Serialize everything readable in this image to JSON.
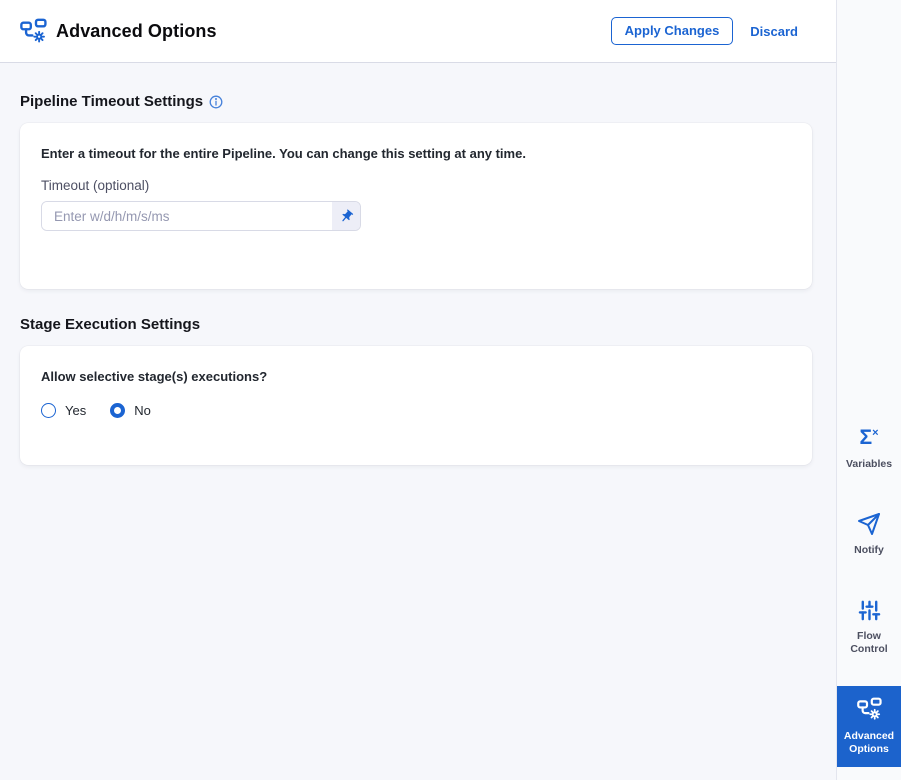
{
  "header": {
    "title": "Advanced Options",
    "apply_label": "Apply Changes",
    "discard_label": "Discard",
    "icon": "pipeline-gear-icon"
  },
  "pipeline_timeout": {
    "section_title": "Pipeline Timeout Settings",
    "info_icon": "info-icon",
    "description": "Enter a timeout for the entire Pipeline. You can change this setting at any time.",
    "timeout_label": "Timeout (optional)",
    "timeout_value": "",
    "timeout_placeholder": "Enter w/d/h/m/s/ms",
    "pin_icon": "pin-icon"
  },
  "stage_execution": {
    "section_title": "Stage Execution Settings",
    "question": "Allow selective stage(s) executions?",
    "options": [
      {
        "label": "Yes",
        "selected": false
      },
      {
        "label": "No",
        "selected": true
      }
    ]
  },
  "sidebar": {
    "items": [
      {
        "label": "Variables",
        "icon": "sigma-x-icon",
        "selected": false
      },
      {
        "label": "Notify",
        "icon": "paper-plane-icon",
        "selected": false
      },
      {
        "label": "Flow Control",
        "icon": "sliders-icon",
        "selected": false
      },
      {
        "label": "Advanced Options",
        "icon": "pipeline-gear-icon",
        "selected": true
      }
    ]
  },
  "colors": {
    "primary": "#1b64d2",
    "selected_nav_bg": "#1c63cc",
    "content_bg": "#f6f7fb",
    "card_bg": "#ffffff"
  }
}
